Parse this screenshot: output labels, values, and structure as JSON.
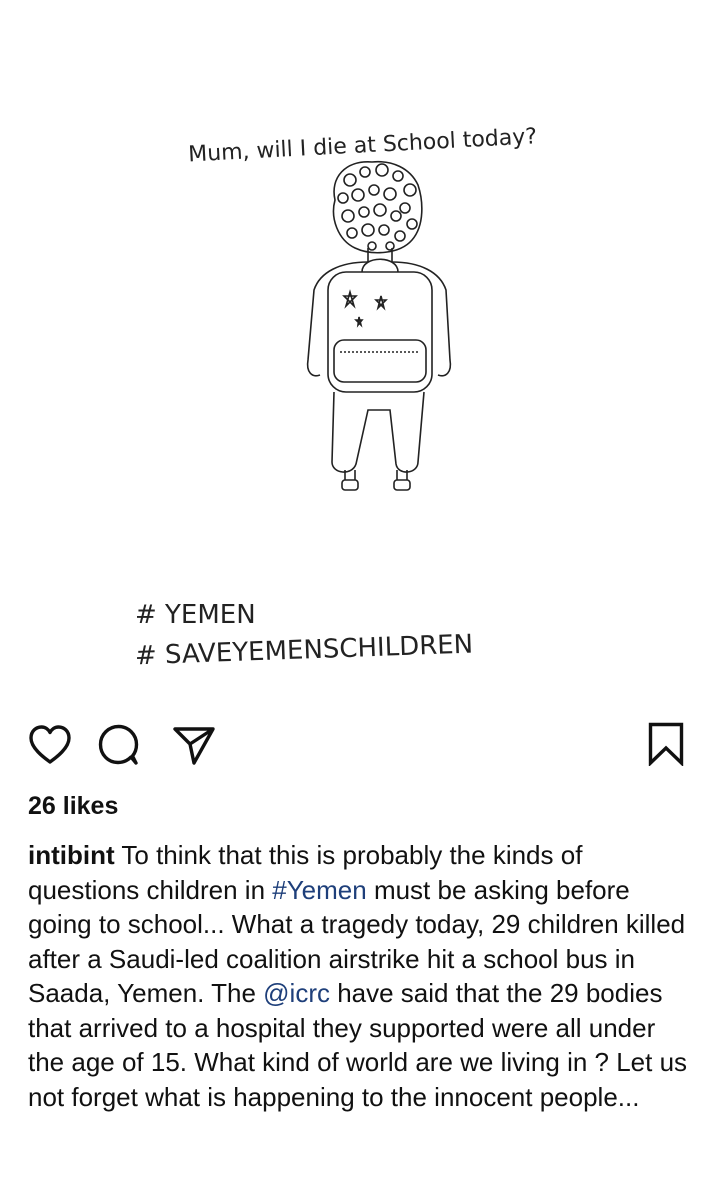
{
  "post": {
    "image": {
      "question": "Mum, will I die at School today?",
      "hashtag_1": "# YEMEN",
      "hashtag_2": "# SAVEYEMENSCHILDREN"
    },
    "actions": {
      "like_icon": "heart-icon",
      "comment_icon": "comment-icon",
      "share_icon": "paper-plane-icon",
      "save_icon": "bookmark-icon"
    },
    "likes_text": "26 likes",
    "caption": {
      "username": "intibint",
      "part1": " To think that this is probably the kinds of questions children in ",
      "hashtag": "#Yemen",
      "part2": " must be asking before going to school... What a tragedy today, 29 children killed after a Saudi-led coalition airstrike hit a school bus in Saada, Yemen. The ",
      "mention": "@icrc",
      "part3": " have said that the 29 bodies that arrived to a hospital they supported were all under the age of 15. What kind of world are we living in ? Let us not forget what is happening to the innocent people..."
    },
    "colors": {
      "link": "#1e3f7a",
      "text": "#111111",
      "background": "#ffffff"
    }
  }
}
